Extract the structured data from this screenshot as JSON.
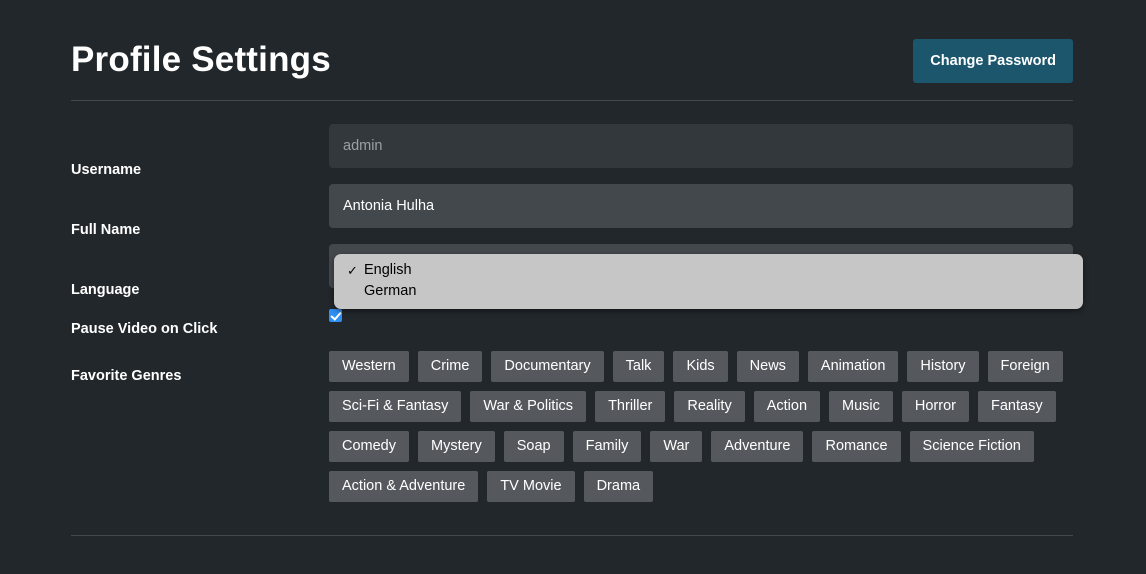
{
  "header": {
    "title": "Profile Settings",
    "change_password_label": "Change Password"
  },
  "form": {
    "username": {
      "label": "Username",
      "value": "admin",
      "disabled": true
    },
    "full_name": {
      "label": "Full Name",
      "value": "Antonia Hulha",
      "disabled": false
    },
    "language": {
      "label": "Language",
      "selected": "English",
      "open": true,
      "options": [
        {
          "label": "English",
          "checked": true,
          "tick": "✓"
        },
        {
          "label": "German",
          "checked": false,
          "tick": ""
        }
      ]
    },
    "pause_video_on_click": {
      "label": "Pause Video on Click",
      "checked": true
    },
    "favorite_genres": {
      "label": "Favorite Genres",
      "tags": [
        "Western",
        "Crime",
        "Documentary",
        "Talk",
        "Kids",
        "News",
        "Animation",
        "History",
        "Foreign",
        "Sci-Fi & Fantasy",
        "War & Politics",
        "Thriller",
        "Reality",
        "Action",
        "Music",
        "Horror",
        "Fantasy",
        "Comedy",
        "Mystery",
        "Soap",
        "Family",
        "War",
        "Adventure",
        "Romance",
        "Science Fiction",
        "Action & Adventure",
        "TV Movie",
        "Drama"
      ]
    }
  },
  "colors": {
    "background": "#22272b",
    "accent_button": "#1b566d",
    "input_enabled": "#43484d",
    "input_disabled": "#33383c",
    "tag": "#55595e",
    "checkbox": "#2f8ff2",
    "popup": "#c6c6c6",
    "divider": "#43484d"
  }
}
